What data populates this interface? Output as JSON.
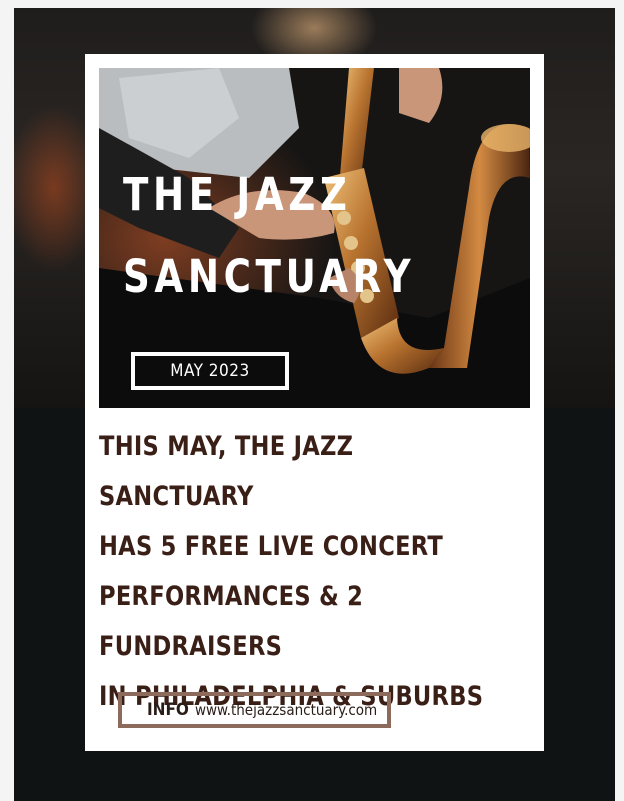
{
  "poster": {
    "title_line1": "THE JAZZ",
    "title_line2": "SANCTUARY",
    "date": "MAY 2023",
    "headline": "THIS MAY, THE JAZZ SANCTUARY\nHAS 5 FREE LIVE CONCERT\nPERFORMANCES & 2 FUNDRAISERS\nIN PHILADELPHIA & SUBURBS",
    "info_label": "INFO",
    "info_url": "www.thejazzsanctuary.com"
  },
  "colors": {
    "page_background": "#101314",
    "card": "#ffffff",
    "headline_text": "#3a1f17",
    "info_border": "#8c6a5c",
    "saxophone_brass": "#b8732f"
  }
}
